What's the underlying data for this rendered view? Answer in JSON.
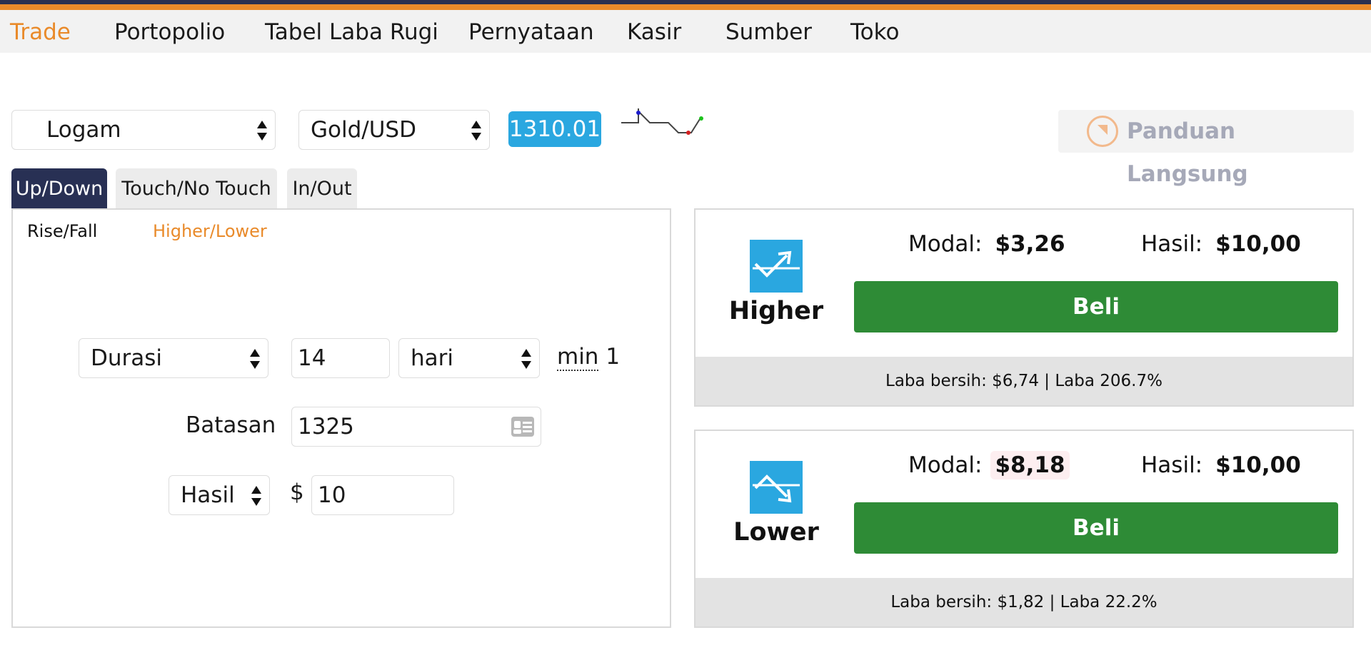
{
  "menu": {
    "items": [
      "Trade",
      "Portopolio",
      "Tabel Laba Rugi",
      "Pernyataan",
      "Kasir",
      "Sumber",
      "Toko"
    ],
    "active": "Trade"
  },
  "market": {
    "category": "Logam",
    "symbol": "Gold/USD",
    "price": "1310.01"
  },
  "guide": {
    "label": "Panduan Langsung"
  },
  "contract_tabs": [
    "Up/Down",
    "Touch/No Touch",
    "In/Out"
  ],
  "sub_tabs": [
    "Rise/Fall",
    "Higher/Lower"
  ],
  "form": {
    "duration_label": "Durasi",
    "duration_value": "14",
    "duration_unit": "hari",
    "min_text": "min",
    "min_value": "1",
    "barrier_label": "Batasan",
    "barrier_value": "1325",
    "payout_type": "Hasil",
    "currency_symbol": "$",
    "amount": "10"
  },
  "contracts": [
    {
      "direction": "Higher",
      "modal_label": "Modal:",
      "modal_value": "$3,26",
      "hasil_label": "Hasil:",
      "hasil_value": "$10,00",
      "buy_label": "Beli",
      "footer": "Laba bersih: $6,74 | Laba 206.7%"
    },
    {
      "direction": "Lower",
      "modal_label": "Modal:",
      "modal_value": "$8,18",
      "hasil_label": "Hasil:",
      "hasil_value": "$10,00",
      "buy_label": "Beli",
      "footer": "Laba bersih: $1,82 | Laba 22.2%"
    }
  ],
  "colors": {
    "accent_orange": "#e98a2a",
    "navy": "#283054",
    "price_blue": "#2aa7e0",
    "buy_green": "#2e8b36"
  }
}
